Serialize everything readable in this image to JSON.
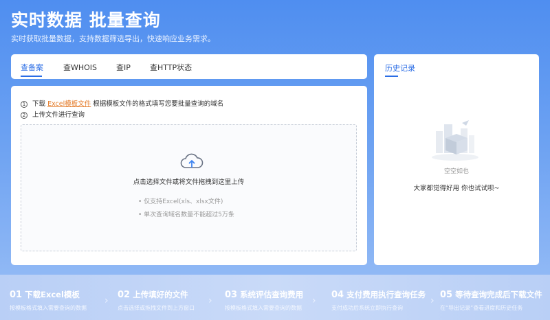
{
  "hero": {
    "title": "实时数据  批量查询",
    "subtitle": "实时获取批量数据，支持数据筛选导出，快速响应业务需求。"
  },
  "tabs": [
    {
      "label": "查备案",
      "active": true
    },
    {
      "label": "查WHOIS",
      "active": false
    },
    {
      "label": "查IP",
      "active": false
    },
    {
      "label": "查HTTP状态",
      "active": false
    }
  ],
  "upload": {
    "step1_num": "1",
    "step1_prefix": "下载",
    "step1_link": "Excel模板文件",
    "step1_suffix": "根据模板文件的格式填写您要批量查询的域名",
    "step2_num": "2",
    "step2_text": "上传文件进行查询",
    "drop_text": "点击选择文件或将文件拖拽到这里上传",
    "note1": "• 仅支持Excel(xls、xlsx文件)",
    "note2": "• 单次查询域名数量不能超过5万条"
  },
  "history": {
    "title": "历史记录",
    "empty_title": "空空如也",
    "empty_sub": "大家都觉得好用 你也试试呗~"
  },
  "steps": [
    {
      "num": "01",
      "title": "下载Excel模板",
      "desc": "按模板格式填入需要查询的数据"
    },
    {
      "num": "02",
      "title": "上传填好的文件",
      "desc": "点击选择或拖拽文件到上方窗口"
    },
    {
      "num": "03",
      "title": "系统评估查询费用",
      "desc": "按模板格式填入需要查询的数据"
    },
    {
      "num": "04",
      "title": "支付费用执行查询任务",
      "desc": "支付成功后系统立即执行查询"
    },
    {
      "num": "05",
      "title": "等待查询完成后下载文件",
      "desc": "在“导出记录”查看进度和历史任务"
    }
  ],
  "colors": {
    "accent": "#2b6de5",
    "link": "#e47a27",
    "background_top": "#4f8ef0"
  }
}
